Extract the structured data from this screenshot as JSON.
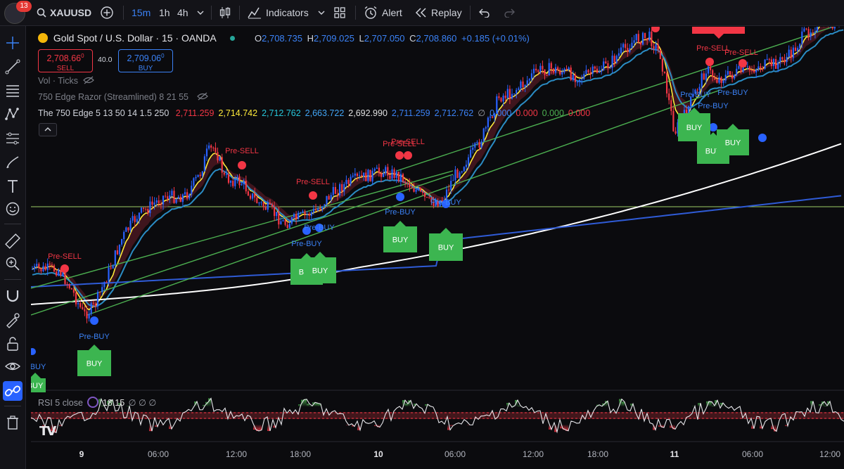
{
  "topbar": {
    "badge": "13",
    "symbol": "XAUUSD",
    "intervals": [
      "15m",
      "1h",
      "4h"
    ],
    "indicators_label": "Indicators",
    "alert_label": "Alert",
    "replay_label": "Replay"
  },
  "legend": {
    "title": "Gold Spot / U.S. Dollar · 15 · OANDA",
    "o_label": "O",
    "o": "2,708.735",
    "h_label": "H",
    "h": "2,709.025",
    "l_label": "L",
    "l": "2,707.050",
    "c_label": "C",
    "c": "2,708.860",
    "change": "+0.185 (+0.01%)",
    "sell_price": "2,708.66",
    "sell_sup": "0",
    "sell_label": "SELL",
    "spread": "40.0",
    "buy_price": "2,709.06",
    "buy_sup": "0",
    "buy_label": "BUY",
    "vol_label": "Vol · Ticks",
    "razor_label": "750 Edge Razor (Streamlined) 8 21 55",
    "edge_label": "The 750 Edge 5 13 50 14 1.5 250",
    "edge_values": [
      {
        "v": "2,711.259",
        "color": "#f23645"
      },
      {
        "v": "2,714.742",
        "color": "#ffeb3b"
      },
      {
        "v": "2,712.762",
        "color": "#26c6da"
      },
      {
        "v": "2,663.722",
        "color": "#42a5f5"
      },
      {
        "v": "2,692.990",
        "color": "#e0e0e0"
      },
      {
        "v": "2,711.259",
        "color": "#3b82f6"
      },
      {
        "v": "2,712.762",
        "color": "#3b82f6"
      },
      {
        "v": "∅",
        "color": "#9598a1"
      },
      {
        "v": "0.000",
        "color": "#3b82f6"
      },
      {
        "v": "0.000",
        "color": "#f23645"
      },
      {
        "v": "0.000",
        "color": "#4caf50"
      },
      {
        "v": "0.000",
        "color": "#f23645"
      }
    ]
  },
  "rsi": {
    "label": "RSI 5 close",
    "value": "18.15",
    "extra": "∅ ∅ ∅"
  },
  "time_axis": [
    "9",
    "06:00",
    "12:00",
    "18:00",
    "10",
    "06:00",
    "12:00",
    "18:00",
    "11",
    "06:00",
    "12:00"
  ],
  "signals": {
    "pre_sell": "Pre-SELL",
    "pre_buy": "Pre-BUY",
    "buy": "BUY"
  },
  "colors": {
    "up": "#2962ff",
    "down": "#f23645",
    "yellow_ema": "#ffeb3b",
    "teal_ema": "#2b8cc4",
    "white_ma": "#ffffff",
    "blue_ma": "#2f5bd6",
    "green_line": "#4caf50",
    "buy_box": "#3cb550"
  }
}
